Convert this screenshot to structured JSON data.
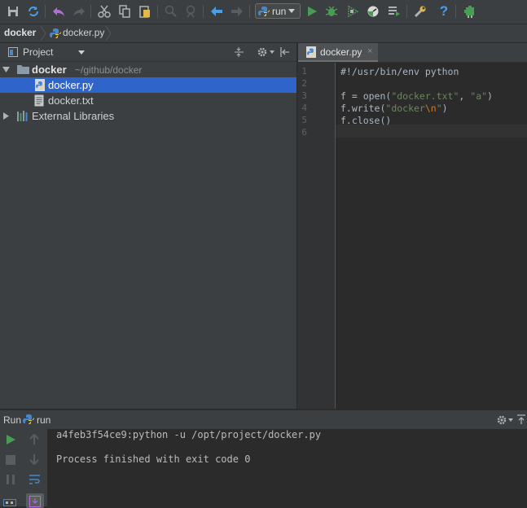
{
  "toolbar": {
    "run_config_label": "run",
    "help_label": "?"
  },
  "breadcrumb": {
    "project": "docker",
    "file": "docker.py"
  },
  "project_panel": {
    "title": "Project",
    "tree": [
      {
        "name": "docker",
        "path": "~/github/docker",
        "type": "folder",
        "expanded": true
      },
      {
        "name": "docker.py",
        "type": "python-file",
        "selected": true
      },
      {
        "name": "docker.txt",
        "type": "text-file"
      },
      {
        "name": "External Libraries",
        "type": "libraries",
        "expanded": false
      }
    ]
  },
  "editor": {
    "tab_label": "docker.py",
    "line_numbers": [
      "1",
      "2",
      "3",
      "4",
      "5",
      "6"
    ],
    "lines": [
      "#!/usr/bin/env python",
      "",
      "f = open(\"docker.txt\", \"a\")",
      "f.write(\"docker\\n\")",
      "f.close()",
      ""
    ]
  },
  "run_panel": {
    "label": "Run",
    "config_name": "run",
    "console_lines": [
      "a4feb3f54ce9:python -u /opt/project/docker.py",
      "",
      "Process finished with exit code 0"
    ]
  },
  "colors": {
    "selection": "#2f65ca",
    "run_green": "#499c54",
    "background": "#2b2b2b",
    "panel": "#3c3f41"
  }
}
